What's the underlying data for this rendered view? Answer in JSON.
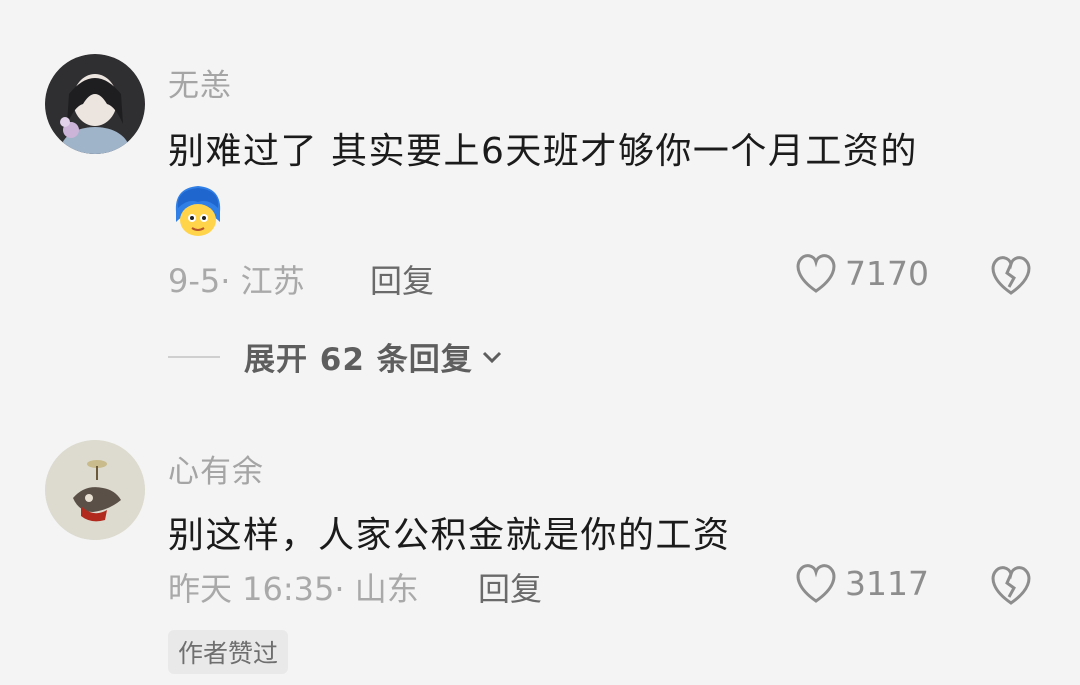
{
  "comments": [
    {
      "username": "无恙",
      "content": "别难过了   其实要上6天班才够你一个月工资的",
      "emoji": "blue-haired-face-emoji",
      "meta": "9-5· 江苏",
      "reply_label": "回复",
      "likes": "7170",
      "expand_label": "展开 62 条回复"
    },
    {
      "username": "心有余",
      "content": "别这样，人家公积金就是你的工资",
      "meta": "昨天 16:35· 山东",
      "reply_label": "回复",
      "likes": "3117",
      "badge": "作者赞过"
    }
  ],
  "colors": {
    "background": "#f4f4f4",
    "username": "#a5a5a5",
    "content": "#1b1b1b",
    "meta": "#a9a9a9"
  }
}
